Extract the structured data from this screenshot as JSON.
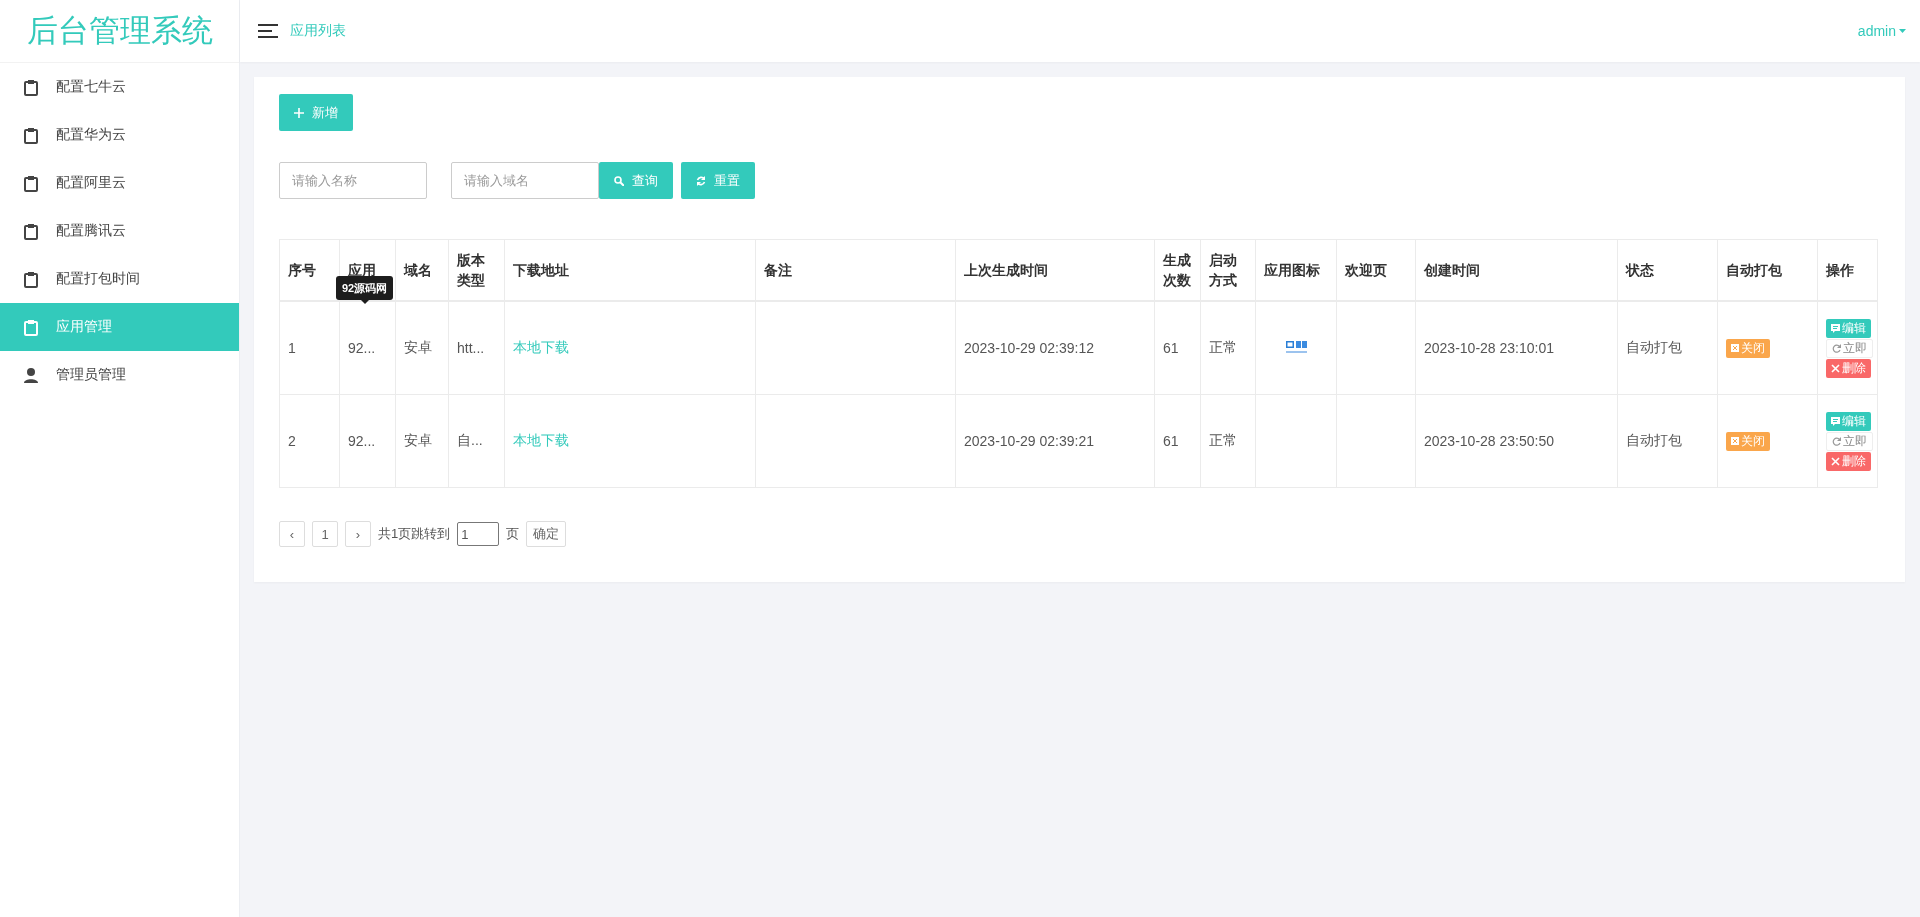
{
  "sidebar": {
    "logo": "后台管理系统",
    "items": [
      {
        "label": "配置七牛云",
        "kind": "page",
        "selected": false
      },
      {
        "label": "配置华为云",
        "kind": "page",
        "selected": false
      },
      {
        "label": "配置阿里云",
        "kind": "page",
        "selected": false
      },
      {
        "label": "配置腾讯云",
        "kind": "page",
        "selected": false
      },
      {
        "label": "配置打包时间",
        "kind": "page",
        "selected": false
      },
      {
        "label": "应用管理",
        "kind": "page",
        "selected": true
      },
      {
        "label": "管理员管理",
        "kind": "user",
        "selected": false
      }
    ]
  },
  "topbar": {
    "page_title": "应用列表",
    "user": "admin"
  },
  "toolbar": {
    "add_button": "新增",
    "name_field": {
      "placeholder": "请输入名称"
    },
    "domain_field": {
      "placeholder": "请输入域名"
    },
    "search_button": "查询",
    "reset_button": "重置"
  },
  "table": {
    "columns": [
      "序号",
      "应用",
      "域名",
      "版本类型",
      "下载地址",
      "备注",
      "上次生成时间",
      "生成次数",
      "启动方式",
      "应用图标",
      "欢迎页",
      "创建时间",
      "状态",
      "自动打包",
      "操作"
    ],
    "tooltip": "92源码网",
    "rows": [
      {
        "index": "1",
        "app_name": "92...",
        "domain": "安卓",
        "version_type": "htt...",
        "download_link": "本地下载",
        "last_generated": "2023-10-29 02:39:12",
        "generation_count": "61",
        "launch_mode": "正常",
        "created": "2023-10-28 23:10:01",
        "status": "自动打包",
        "auto_pack_button": "关闭",
        "actions": [
          {
            "label": "编辑",
            "kind": "edit"
          },
          {
            "label": "立即",
            "kind": "run"
          },
          {
            "label": "删除",
            "kind": "delete"
          }
        ]
      },
      {
        "index": "2",
        "app_name": "92...",
        "domain": "安卓",
        "version_type": "自...",
        "download_link": "本地下载",
        "last_generated": "2023-10-29 02:39:21",
        "generation_count": "61",
        "launch_mode": "正常",
        "created": "2023-10-28 23:50:50",
        "status": "自动打包",
        "auto_pack_button": "关闭",
        "actions": [
          {
            "label": "编辑",
            "kind": "edit"
          },
          {
            "label": "立即",
            "kind": "run"
          },
          {
            "label": "删除",
            "kind": "delete"
          }
        ]
      }
    ]
  },
  "pagination": {
    "prev": "‹",
    "pages": [
      {
        "label": "1"
      }
    ],
    "next": "›",
    "total_text": "共1页跳转到",
    "jump_value": "1",
    "unit": "页",
    "confirm": "确定"
  }
}
